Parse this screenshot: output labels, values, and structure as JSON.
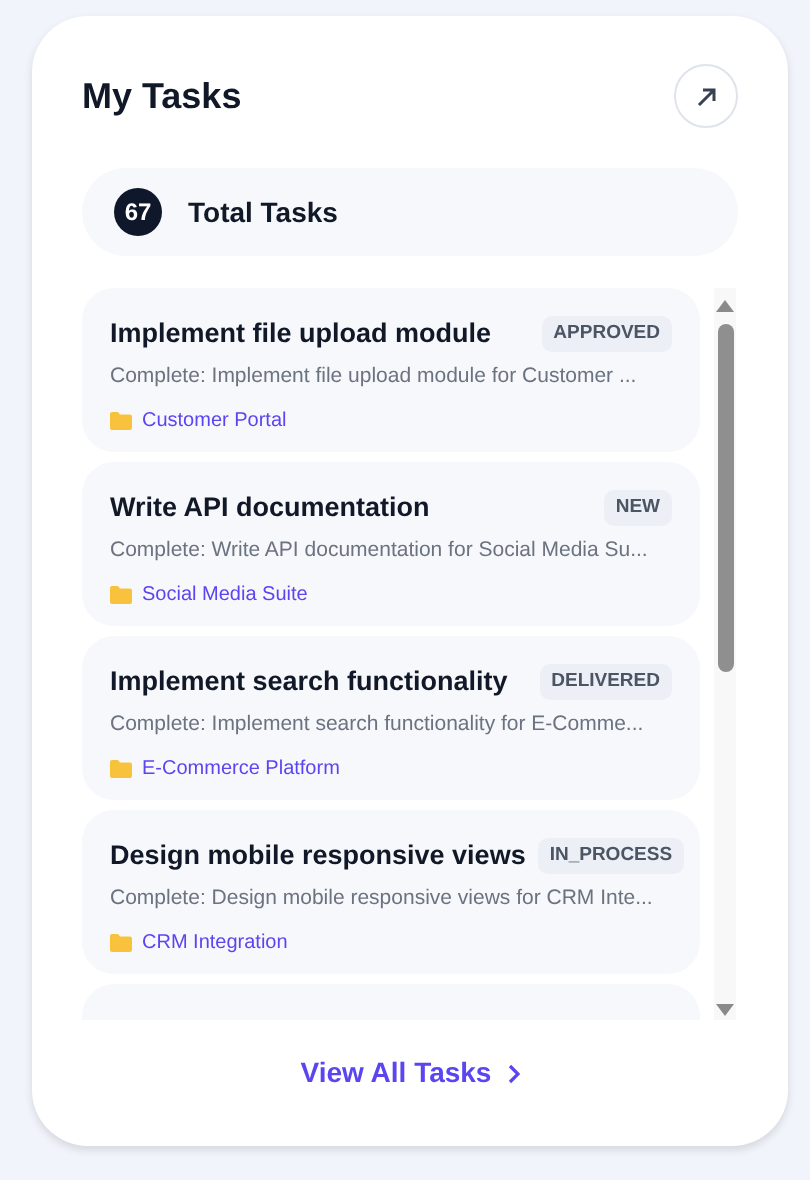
{
  "header": {
    "title": "My Tasks"
  },
  "summary": {
    "count": "67",
    "label": "Total Tasks"
  },
  "tasks": [
    {
      "title": "Implement file upload module",
      "status": "APPROVED",
      "description": "Complete: Implement file upload module for Customer ...",
      "project": "Customer Portal"
    },
    {
      "title": "Write API documentation",
      "status": "NEW",
      "description": "Complete: Write API documentation for Social Media Su...",
      "project": "Social Media Suite"
    },
    {
      "title": "Implement search functionality",
      "status": "DELIVERED",
      "description": "Complete: Implement search functionality for E-Comme...",
      "project": "E-Commerce Platform"
    },
    {
      "title": "Design mobile responsive views",
      "status": "IN_PROCESS",
      "description": "Complete: Design mobile responsive views for CRM Inte...",
      "project": "CRM Integration"
    }
  ],
  "footer": {
    "link": "View All Tasks"
  }
}
